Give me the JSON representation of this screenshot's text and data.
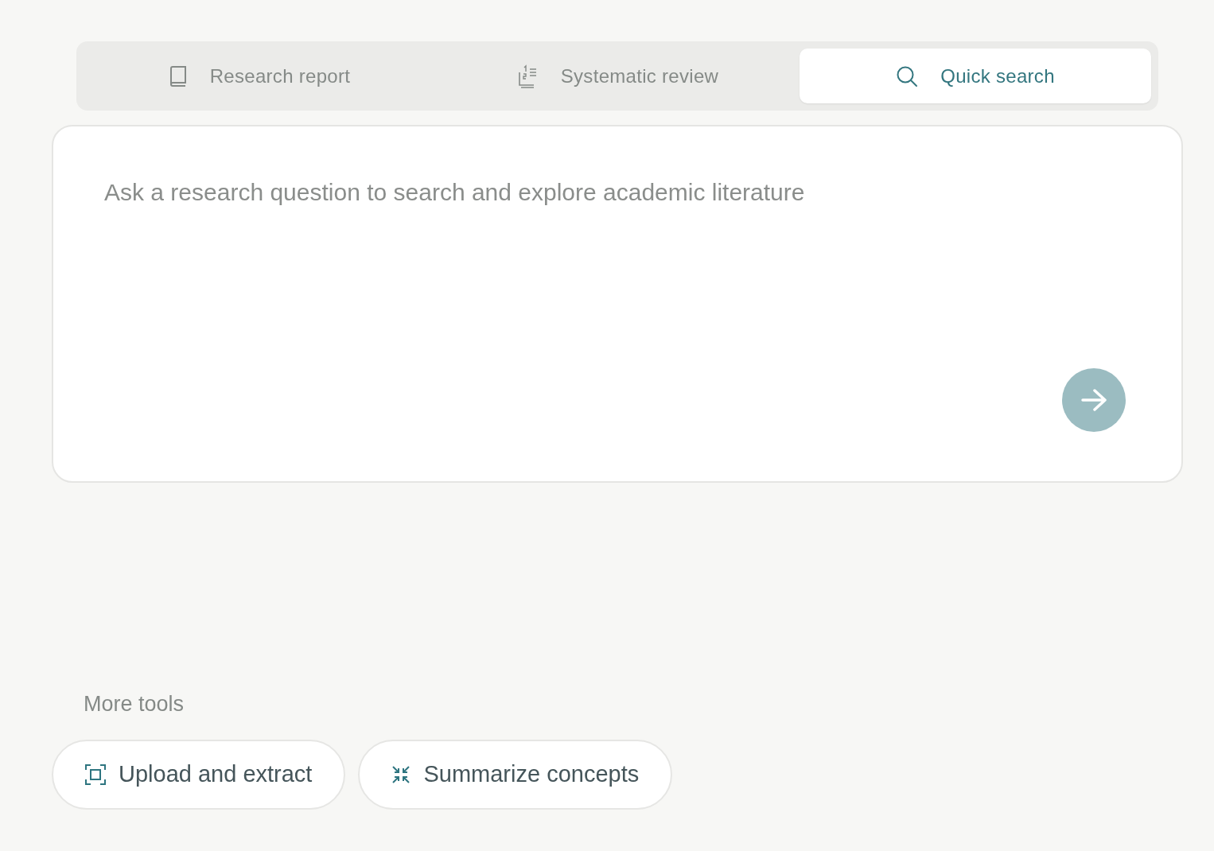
{
  "tabs": [
    {
      "label": "Research report",
      "selected": false
    },
    {
      "label": "Systematic review",
      "selected": false
    },
    {
      "label": "Quick search",
      "selected": true
    }
  ],
  "query": {
    "placeholder": "Ask a research question to search and explore academic literature",
    "submit_disabled": true
  },
  "more_tools": {
    "heading": "More tools",
    "buttons": [
      "Upload and extract",
      "Summarize concepts"
    ]
  }
}
